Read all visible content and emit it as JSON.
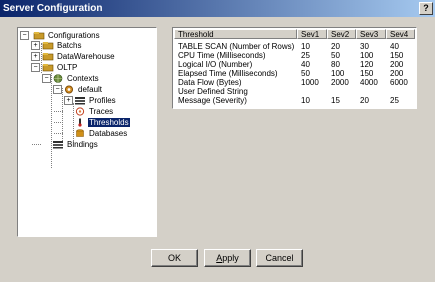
{
  "window": {
    "title": "Server Configuration",
    "help_label": "?"
  },
  "tree": {
    "configurations": "Configurations",
    "batchs": "Batchs",
    "datawarehouse": "DataWarehouse",
    "oltp": "OLTP",
    "contexts": "Contexts",
    "default": "default",
    "profiles": "Profiles",
    "traces": "Traces",
    "thresholds": "Thresholds",
    "databases": "Databases",
    "bindings": "Bindings",
    "selected": "Thresholds"
  },
  "grid": {
    "columns": [
      "Threshold",
      "Sev1",
      "Sev2",
      "Sev3",
      "Sev4"
    ],
    "rows": [
      [
        "TABLE SCAN (Number of Rows)",
        "10",
        "20",
        "30",
        "40"
      ],
      [
        "CPU Time (Milliseconds)",
        "25",
        "50",
        "100",
        "150"
      ],
      [
        "Logical I/O (Number)",
        "40",
        "80",
        "120",
        "200"
      ],
      [
        "Elapsed Time (Milliseconds)",
        "50",
        "100",
        "150",
        "200"
      ],
      [
        "Data Flow (Bytes)",
        "1000",
        "2000",
        "4000",
        "6000"
      ],
      [
        "User Defined String",
        "",
        "",
        "",
        ""
      ],
      [
        "Message (Severity)",
        "10",
        "15",
        "20",
        "25"
      ]
    ]
  },
  "buttons": {
    "ok": "OK",
    "apply_prefix": "A",
    "apply_rest": "pply",
    "cancel": "Cancel"
  }
}
